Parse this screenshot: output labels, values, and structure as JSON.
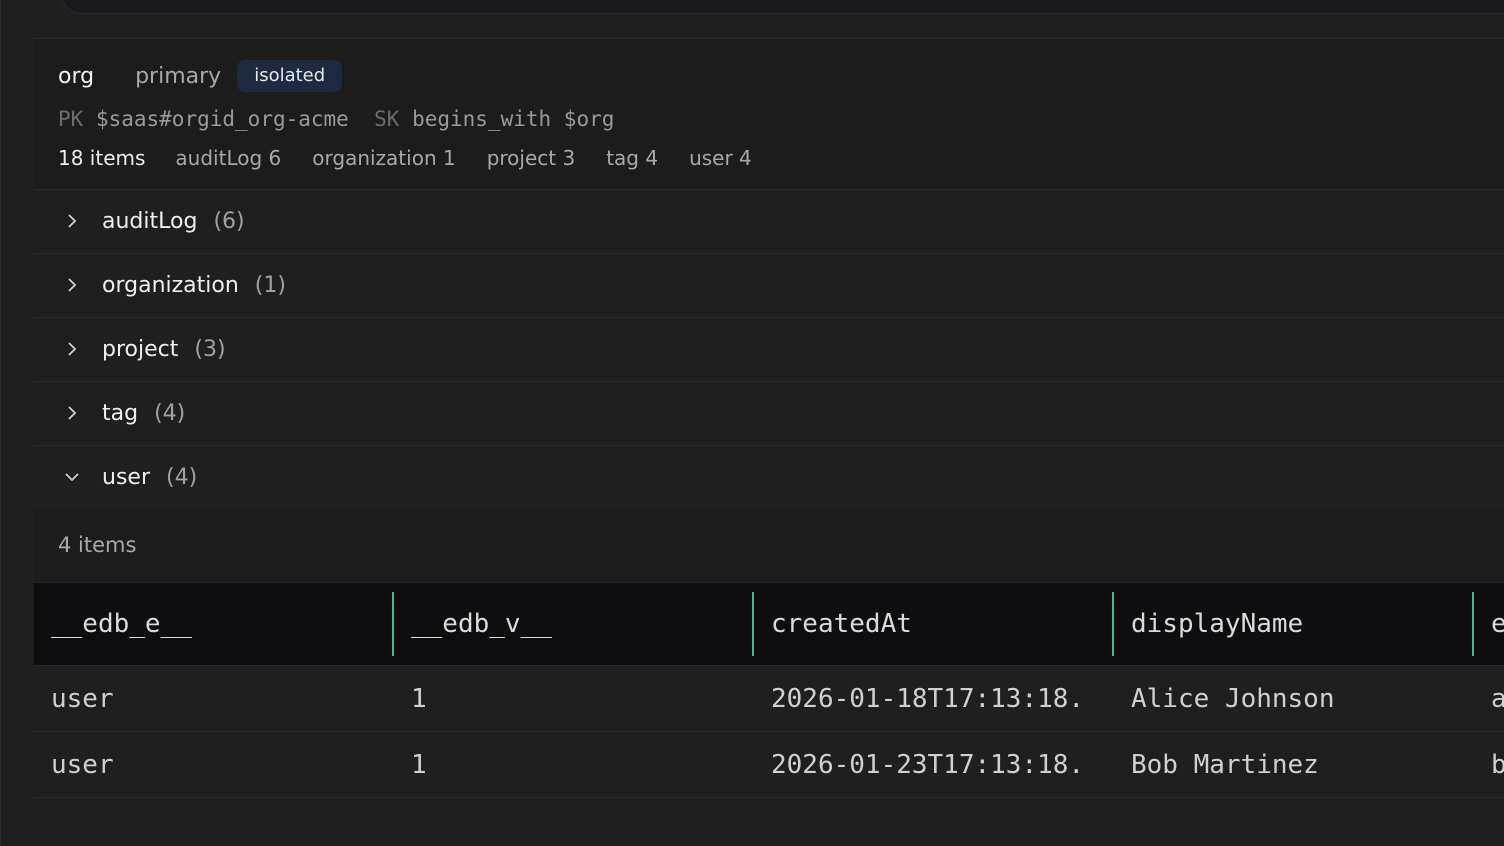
{
  "entity": {
    "name": "org",
    "index": "primary",
    "badge": "isolated",
    "pk_label": "PK",
    "pk_value": "$saas#orgid_org-acme",
    "sk_label": "SK",
    "sk_value": "begins_with $org",
    "total_items": "18 items",
    "type_counts": [
      "auditLog 6",
      "organization 1",
      "project 3",
      "tag 4",
      "user 4"
    ]
  },
  "groups": [
    {
      "name": "auditLog",
      "count": "(6)",
      "expanded": false
    },
    {
      "name": "organization",
      "count": "(1)",
      "expanded": false
    },
    {
      "name": "project",
      "count": "(3)",
      "expanded": false
    },
    {
      "name": "tag",
      "count": "(4)",
      "expanded": false
    },
    {
      "name": "user",
      "count": "(4)",
      "expanded": true
    }
  ],
  "table": {
    "items_label": "4 items",
    "columns": [
      "__edb_e__",
      "__edb_v__",
      "createdAt",
      "displayName",
      "e"
    ],
    "rows": [
      [
        "user",
        "1",
        "2026-01-18T17:13:18.",
        "Alice Johnson",
        "a"
      ],
      [
        "user",
        "1",
        "2026-01-23T17:13:18.",
        "Bob Martinez",
        "b"
      ]
    ]
  },
  "colors": {
    "background": "#1f1f20",
    "header_bg": "#0e0e10",
    "badge_bg": "#1d2a40",
    "column_divider": "#3fbf90"
  }
}
